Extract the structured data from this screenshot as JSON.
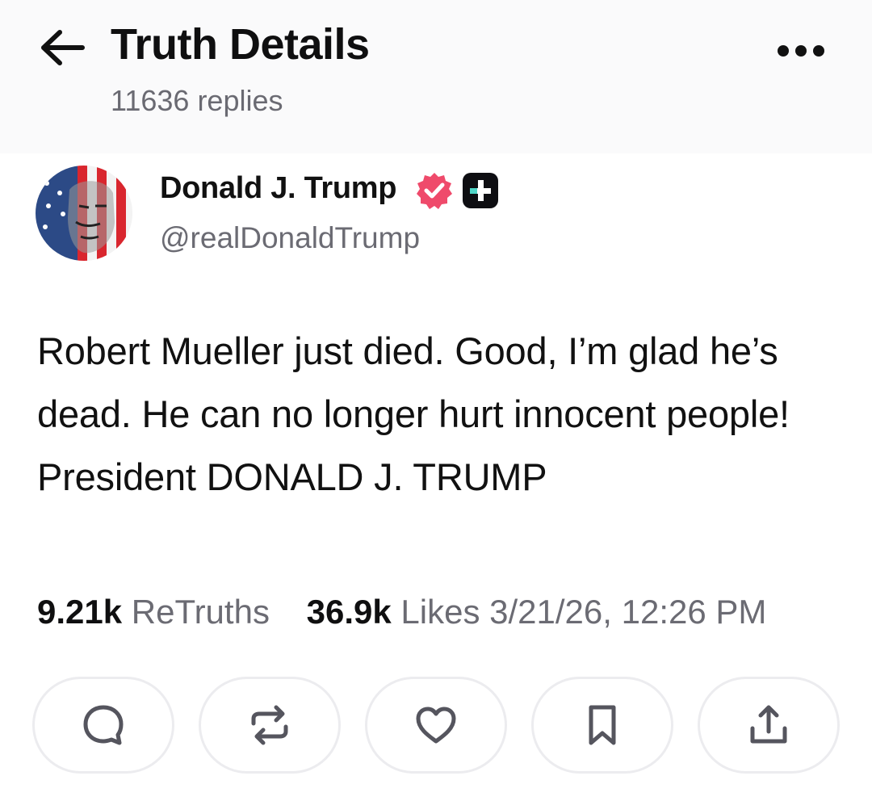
{
  "header": {
    "title": "Truth Details",
    "replies": "11636 replies",
    "back_icon": "arrow-left-icon",
    "more_icon": "more-horizontal-icon"
  },
  "post": {
    "author": {
      "name": "Donald J. Trump",
      "handle": "@realDonaldTrump",
      "verified_color": "#ef4a6b"
    },
    "text": "Robert Mueller just died. Good, I’m glad he’s dead. He can no longer hurt innocent people! President DONALD J. TRUMP",
    "stats": {
      "retruths_count": "9.21k",
      "retruths_label": "ReTruths",
      "likes_count": "36.9k",
      "likes_label": "Likes",
      "timestamp": "3/21/26, 12:26 PM"
    }
  },
  "actions": [
    {
      "icon": "reply-icon"
    },
    {
      "icon": "retruth-icon"
    },
    {
      "icon": "heart-icon"
    },
    {
      "icon": "bookmark-icon"
    },
    {
      "icon": "share-icon"
    }
  ]
}
